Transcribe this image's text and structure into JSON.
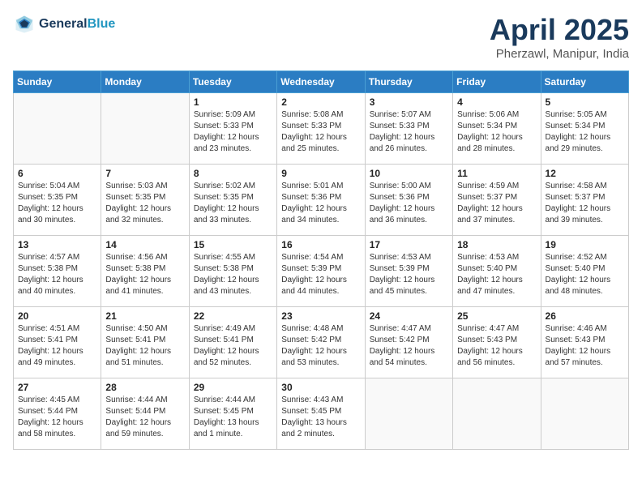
{
  "header": {
    "logo_line1": "General",
    "logo_line2": "Blue",
    "month_year": "April 2025",
    "location": "Pherzawl, Manipur, India"
  },
  "weekdays": [
    "Sunday",
    "Monday",
    "Tuesday",
    "Wednesday",
    "Thursday",
    "Friday",
    "Saturday"
  ],
  "weeks": [
    [
      {
        "day": "",
        "sunrise": "",
        "sunset": "",
        "daylight": ""
      },
      {
        "day": "",
        "sunrise": "",
        "sunset": "",
        "daylight": ""
      },
      {
        "day": "1",
        "sunrise": "Sunrise: 5:09 AM",
        "sunset": "Sunset: 5:33 PM",
        "daylight": "Daylight: 12 hours and 23 minutes."
      },
      {
        "day": "2",
        "sunrise": "Sunrise: 5:08 AM",
        "sunset": "Sunset: 5:33 PM",
        "daylight": "Daylight: 12 hours and 25 minutes."
      },
      {
        "day": "3",
        "sunrise": "Sunrise: 5:07 AM",
        "sunset": "Sunset: 5:33 PM",
        "daylight": "Daylight: 12 hours and 26 minutes."
      },
      {
        "day": "4",
        "sunrise": "Sunrise: 5:06 AM",
        "sunset": "Sunset: 5:34 PM",
        "daylight": "Daylight: 12 hours and 28 minutes."
      },
      {
        "day": "5",
        "sunrise": "Sunrise: 5:05 AM",
        "sunset": "Sunset: 5:34 PM",
        "daylight": "Daylight: 12 hours and 29 minutes."
      }
    ],
    [
      {
        "day": "6",
        "sunrise": "Sunrise: 5:04 AM",
        "sunset": "Sunset: 5:35 PM",
        "daylight": "Daylight: 12 hours and 30 minutes."
      },
      {
        "day": "7",
        "sunrise": "Sunrise: 5:03 AM",
        "sunset": "Sunset: 5:35 PM",
        "daylight": "Daylight: 12 hours and 32 minutes."
      },
      {
        "day": "8",
        "sunrise": "Sunrise: 5:02 AM",
        "sunset": "Sunset: 5:35 PM",
        "daylight": "Daylight: 12 hours and 33 minutes."
      },
      {
        "day": "9",
        "sunrise": "Sunrise: 5:01 AM",
        "sunset": "Sunset: 5:36 PM",
        "daylight": "Daylight: 12 hours and 34 minutes."
      },
      {
        "day": "10",
        "sunrise": "Sunrise: 5:00 AM",
        "sunset": "Sunset: 5:36 PM",
        "daylight": "Daylight: 12 hours and 36 minutes."
      },
      {
        "day": "11",
        "sunrise": "Sunrise: 4:59 AM",
        "sunset": "Sunset: 5:37 PM",
        "daylight": "Daylight: 12 hours and 37 minutes."
      },
      {
        "day": "12",
        "sunrise": "Sunrise: 4:58 AM",
        "sunset": "Sunset: 5:37 PM",
        "daylight": "Daylight: 12 hours and 39 minutes."
      }
    ],
    [
      {
        "day": "13",
        "sunrise": "Sunrise: 4:57 AM",
        "sunset": "Sunset: 5:38 PM",
        "daylight": "Daylight: 12 hours and 40 minutes."
      },
      {
        "day": "14",
        "sunrise": "Sunrise: 4:56 AM",
        "sunset": "Sunset: 5:38 PM",
        "daylight": "Daylight: 12 hours and 41 minutes."
      },
      {
        "day": "15",
        "sunrise": "Sunrise: 4:55 AM",
        "sunset": "Sunset: 5:38 PM",
        "daylight": "Daylight: 12 hours and 43 minutes."
      },
      {
        "day": "16",
        "sunrise": "Sunrise: 4:54 AM",
        "sunset": "Sunset: 5:39 PM",
        "daylight": "Daylight: 12 hours and 44 minutes."
      },
      {
        "day": "17",
        "sunrise": "Sunrise: 4:53 AM",
        "sunset": "Sunset: 5:39 PM",
        "daylight": "Daylight: 12 hours and 45 minutes."
      },
      {
        "day": "18",
        "sunrise": "Sunrise: 4:53 AM",
        "sunset": "Sunset: 5:40 PM",
        "daylight": "Daylight: 12 hours and 47 minutes."
      },
      {
        "day": "19",
        "sunrise": "Sunrise: 4:52 AM",
        "sunset": "Sunset: 5:40 PM",
        "daylight": "Daylight: 12 hours and 48 minutes."
      }
    ],
    [
      {
        "day": "20",
        "sunrise": "Sunrise: 4:51 AM",
        "sunset": "Sunset: 5:41 PM",
        "daylight": "Daylight: 12 hours and 49 minutes."
      },
      {
        "day": "21",
        "sunrise": "Sunrise: 4:50 AM",
        "sunset": "Sunset: 5:41 PM",
        "daylight": "Daylight: 12 hours and 51 minutes."
      },
      {
        "day": "22",
        "sunrise": "Sunrise: 4:49 AM",
        "sunset": "Sunset: 5:41 PM",
        "daylight": "Daylight: 12 hours and 52 minutes."
      },
      {
        "day": "23",
        "sunrise": "Sunrise: 4:48 AM",
        "sunset": "Sunset: 5:42 PM",
        "daylight": "Daylight: 12 hours and 53 minutes."
      },
      {
        "day": "24",
        "sunrise": "Sunrise: 4:47 AM",
        "sunset": "Sunset: 5:42 PM",
        "daylight": "Daylight: 12 hours and 54 minutes."
      },
      {
        "day": "25",
        "sunrise": "Sunrise: 4:47 AM",
        "sunset": "Sunset: 5:43 PM",
        "daylight": "Daylight: 12 hours and 56 minutes."
      },
      {
        "day": "26",
        "sunrise": "Sunrise: 4:46 AM",
        "sunset": "Sunset: 5:43 PM",
        "daylight": "Daylight: 12 hours and 57 minutes."
      }
    ],
    [
      {
        "day": "27",
        "sunrise": "Sunrise: 4:45 AM",
        "sunset": "Sunset: 5:44 PM",
        "daylight": "Daylight: 12 hours and 58 minutes."
      },
      {
        "day": "28",
        "sunrise": "Sunrise: 4:44 AM",
        "sunset": "Sunset: 5:44 PM",
        "daylight": "Daylight: 12 hours and 59 minutes."
      },
      {
        "day": "29",
        "sunrise": "Sunrise: 4:44 AM",
        "sunset": "Sunset: 5:45 PM",
        "daylight": "Daylight: 13 hours and 1 minute."
      },
      {
        "day": "30",
        "sunrise": "Sunrise: 4:43 AM",
        "sunset": "Sunset: 5:45 PM",
        "daylight": "Daylight: 13 hours and 2 minutes."
      },
      {
        "day": "",
        "sunrise": "",
        "sunset": "",
        "daylight": ""
      },
      {
        "day": "",
        "sunrise": "",
        "sunset": "",
        "daylight": ""
      },
      {
        "day": "",
        "sunrise": "",
        "sunset": "",
        "daylight": ""
      }
    ]
  ]
}
